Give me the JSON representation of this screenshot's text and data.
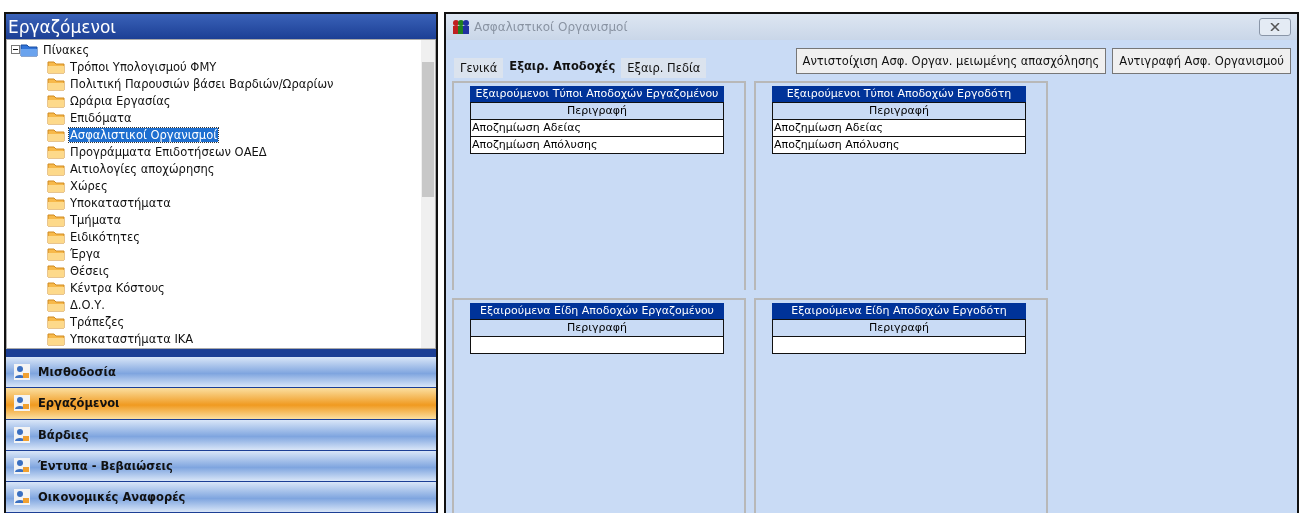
{
  "sidebar": {
    "title": "Εργαζόμενοι",
    "tree": [
      {
        "label": "Πίνακες",
        "expanded": true,
        "children": [
          {
            "label": "Τρόποι Υπολογισμού ΦΜΥ",
            "selected": false
          },
          {
            "label": "Πολιτική Παρουσιών βάσει Βαρδιών/Ωραρίων",
            "selected": false
          },
          {
            "label": "Ωράρια Εργασίας",
            "selected": false
          },
          {
            "label": "Επιδόματα",
            "selected": false
          },
          {
            "label": "Ασφαλιστικοί Οργανισμοί",
            "selected": true
          },
          {
            "label": "Προγράμματα Επιδοτήσεων ΟΑΕΔ",
            "selected": false
          },
          {
            "label": "Αιτιολογίες αποχώρησης",
            "selected": false
          },
          {
            "label": "Χώρες",
            "selected": false
          },
          {
            "label": "Υποκαταστήματα",
            "selected": false
          },
          {
            "label": "Τμήματα",
            "selected": false
          },
          {
            "label": "Ειδικότητες",
            "selected": false
          },
          {
            "label": "Έργα",
            "selected": false
          },
          {
            "label": "Θέσεις",
            "selected": false
          },
          {
            "label": "Κέντρα Κόστους",
            "selected": false
          },
          {
            "label": "Δ.Ο.Υ.",
            "selected": false
          },
          {
            "label": "Τράπεζες",
            "selected": false
          },
          {
            "label": "Υποκαταστήματα ΙΚΑ",
            "selected": false
          }
        ]
      }
    ],
    "nav": [
      {
        "label": "Μισθοδοσία",
        "selected": false
      },
      {
        "label": "Εργαζόμενοι",
        "selected": true
      },
      {
        "label": "Βάρδιες",
        "selected": false
      },
      {
        "label": "Έντυπα - Βεβαιώσεις",
        "selected": false
      },
      {
        "label": "Οικονομικές Αναφορές",
        "selected": false
      }
    ]
  },
  "window": {
    "title": "Ασφαλιστικοί Οργανισμοί",
    "buttons": [
      "Αντιστοίχιση Ασφ. Οργαν. μειωμένης απασχόλησης",
      "Αντιγραφή Ασφ. Οργανισμού"
    ],
    "tabs": [
      {
        "label": "Γενικά",
        "selected": false
      },
      {
        "label": "Εξαιρ. Αποδοχές",
        "selected": true
      },
      {
        "label": "Εξαιρ. Πεδία",
        "selected": false
      }
    ],
    "panels": [
      {
        "title": "Εξαιρούμενοι Τύποι Αποδοχών Εργαζομένου",
        "column": "Περιγραφή",
        "rows": [
          "Αποζημίωση Αδείας",
          "Αποζημίωση Απόλυσης"
        ]
      },
      {
        "title": "Εξαιρούμενοι Τύποι Αποδοχών Εργοδότη",
        "column": "Περιγραφή",
        "rows": [
          "Αποζημίωση Αδείας",
          "Αποζημίωση Απόλυσης"
        ]
      },
      {
        "title": "Εξαιρούμενα Είδη Αποδοχών Εργαζομένου",
        "column": "Περιγραφή"
      },
      {
        "title": "Εξαιρούμενα Είδη Αποδοχών Εργοδότη",
        "column": "Περιγραφή"
      }
    ]
  }
}
